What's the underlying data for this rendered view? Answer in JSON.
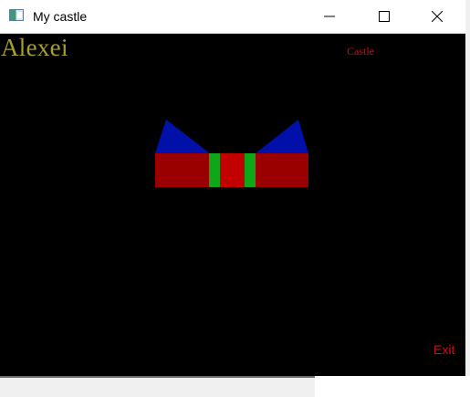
{
  "window": {
    "title": "My castle",
    "icon": "app-window-icon"
  },
  "titlebar": {
    "minimize_icon": "minimize-icon",
    "maximize_icon": "maximize-icon",
    "close_icon": "close-icon"
  },
  "canvas": {
    "user_name": "Alexei",
    "castle_link": "Castle",
    "exit_link": "Exit",
    "colors": {
      "background": "#000000",
      "user_name": "#a6a02e",
      "castle_link": "#c0161d",
      "exit_link": "#d10f16",
      "castle_roof": "#0010a8",
      "castle_wall": "#9a0000",
      "castle_gate": "#c30000",
      "castle_posts": "#0fa617"
    }
  }
}
